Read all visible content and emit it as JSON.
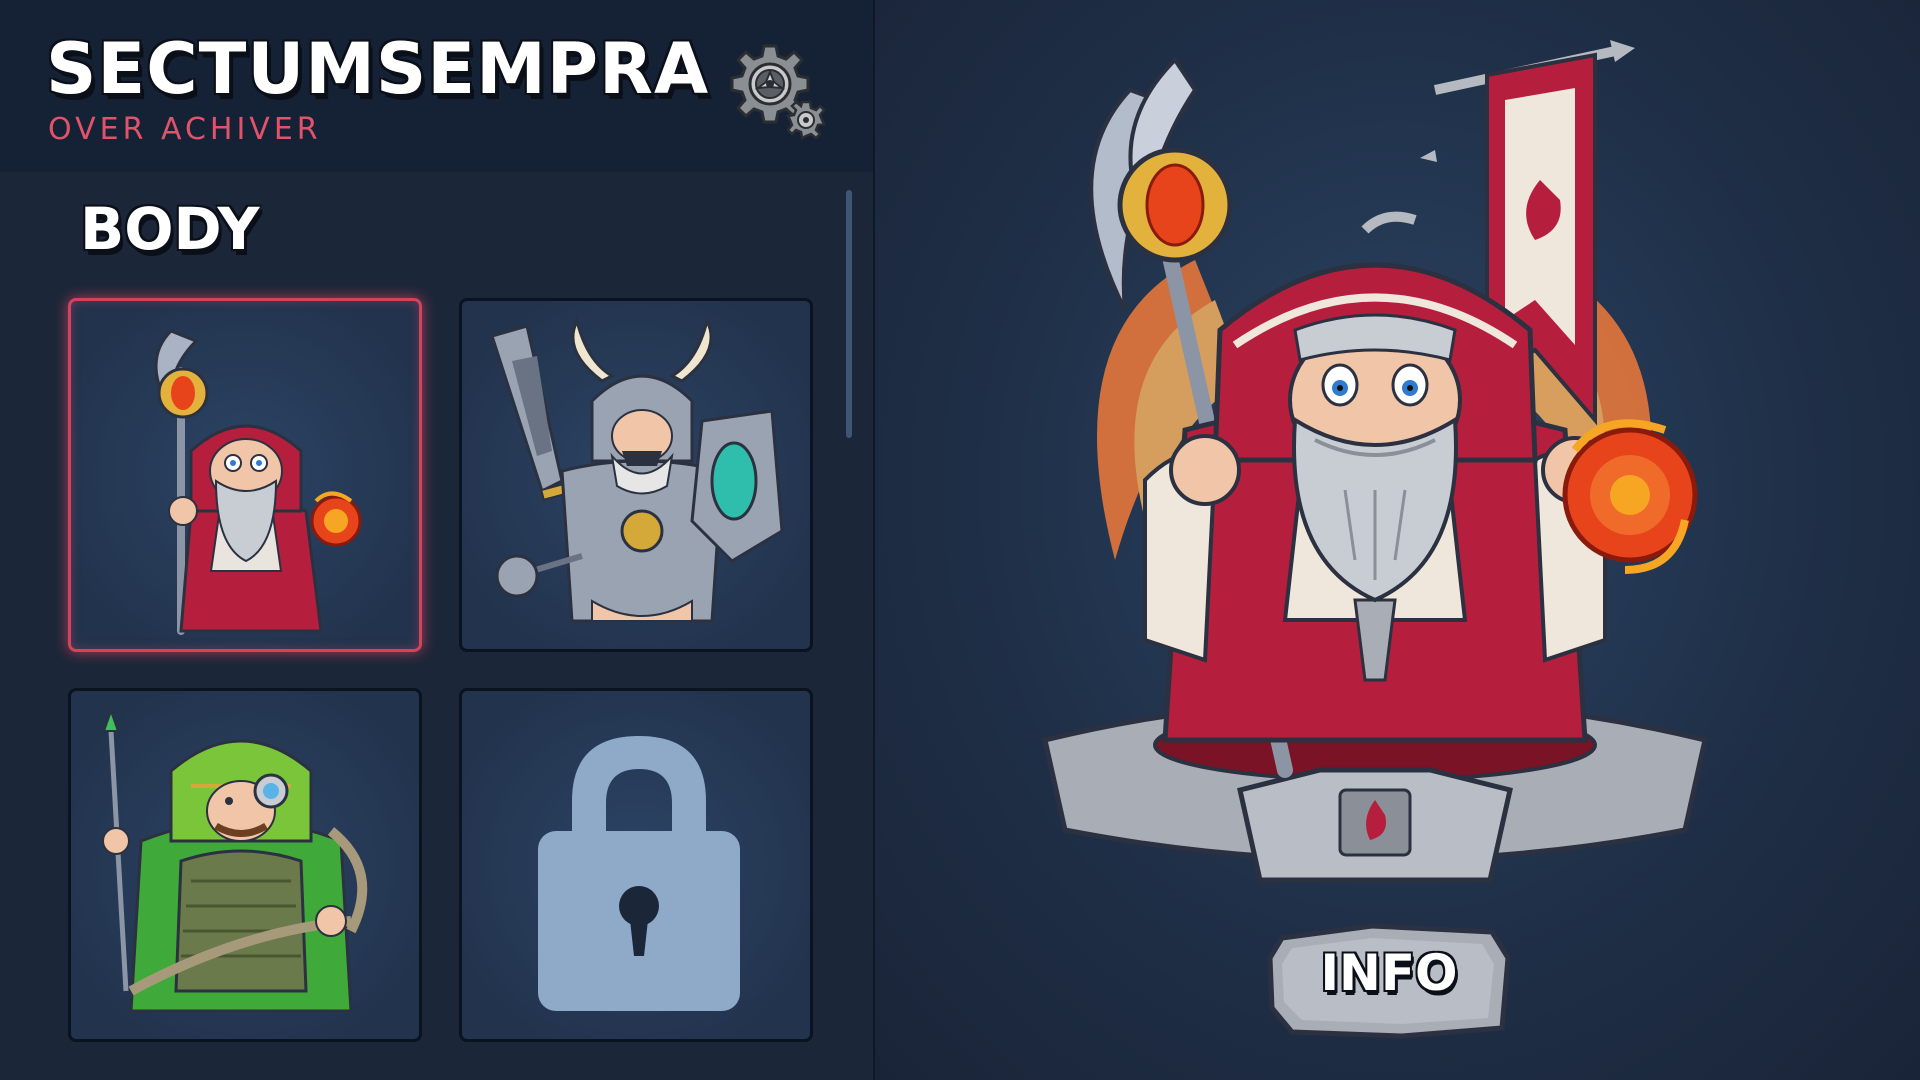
{
  "player": {
    "name": "SECTUMSEMPRA",
    "rank": "OVER ACHIVER"
  },
  "header": {
    "settings_icon": "gear-icon"
  },
  "body_section": {
    "title": "BODY",
    "items": [
      {
        "character": "wizard",
        "selected": true,
        "locked": false
      },
      {
        "character": "knight",
        "selected": false,
        "locked": false
      },
      {
        "character": "archer",
        "selected": false,
        "locked": false
      },
      {
        "character": "locked",
        "selected": false,
        "locked": true,
        "icon": "lock-icon"
      }
    ]
  },
  "preview": {
    "character": "wizard",
    "info_label": "INFO"
  },
  "colors": {
    "accent": "#e0536a",
    "selected_border": "#d2445e",
    "panel_bg": "#1b2738",
    "header_bg": "#152135",
    "lock": "#8fa9c8"
  }
}
